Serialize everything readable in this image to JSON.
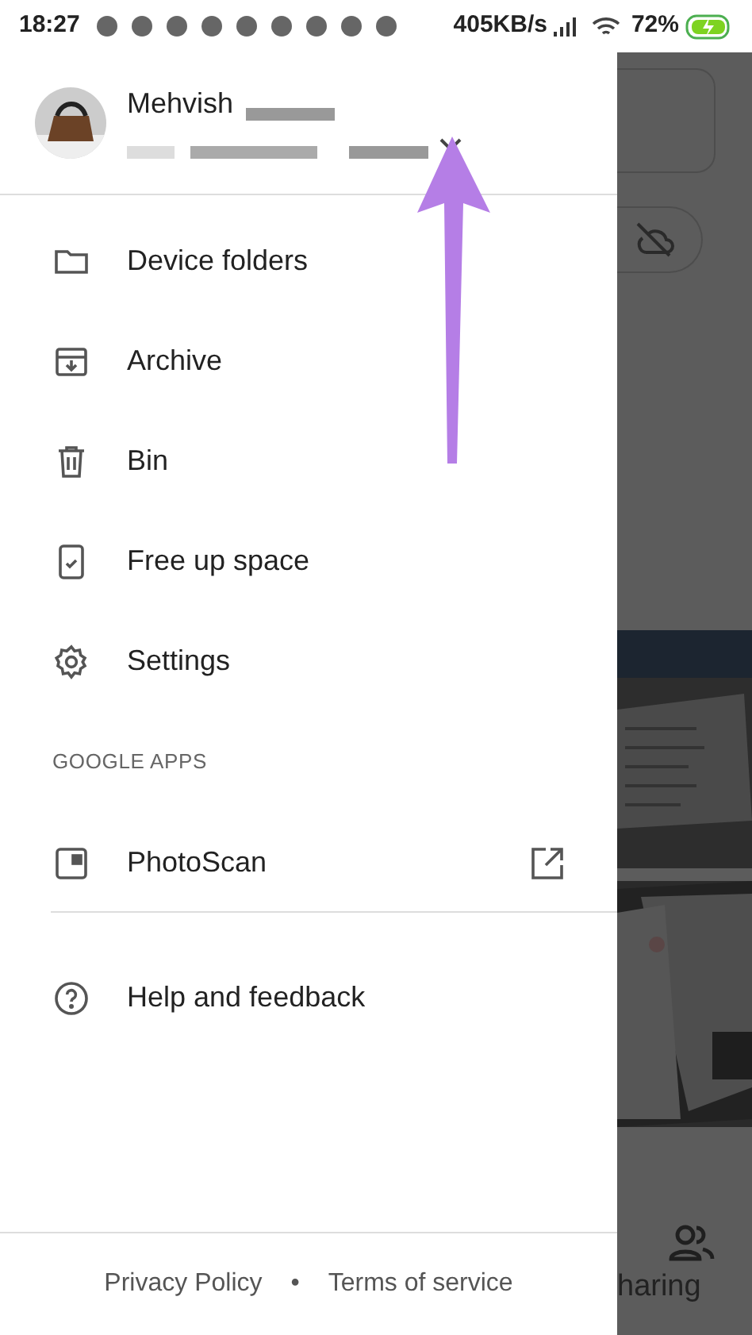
{
  "status_bar": {
    "time": "18:27",
    "speed": "405KB/s",
    "battery": "72%"
  },
  "account": {
    "name": "Mehvish"
  },
  "menu": [
    {
      "kind": "item",
      "label": "Device folders"
    },
    {
      "kind": "item",
      "label": "Archive"
    },
    {
      "kind": "item",
      "label": "Bin"
    },
    {
      "kind": "item",
      "label": "Free up space"
    },
    {
      "kind": "item",
      "label": "Settings"
    },
    {
      "kind": "header",
      "label": "GOOGLE APPS"
    },
    {
      "kind": "app",
      "label": "PhotoScan"
    },
    {
      "kind": "divider"
    },
    {
      "kind": "item",
      "label": "Help and feedback"
    }
  ],
  "footer": {
    "links": [
      "Privacy Policy",
      "Terms of service"
    ],
    "separator": "•"
  },
  "background": {
    "nav_label": "haring"
  }
}
